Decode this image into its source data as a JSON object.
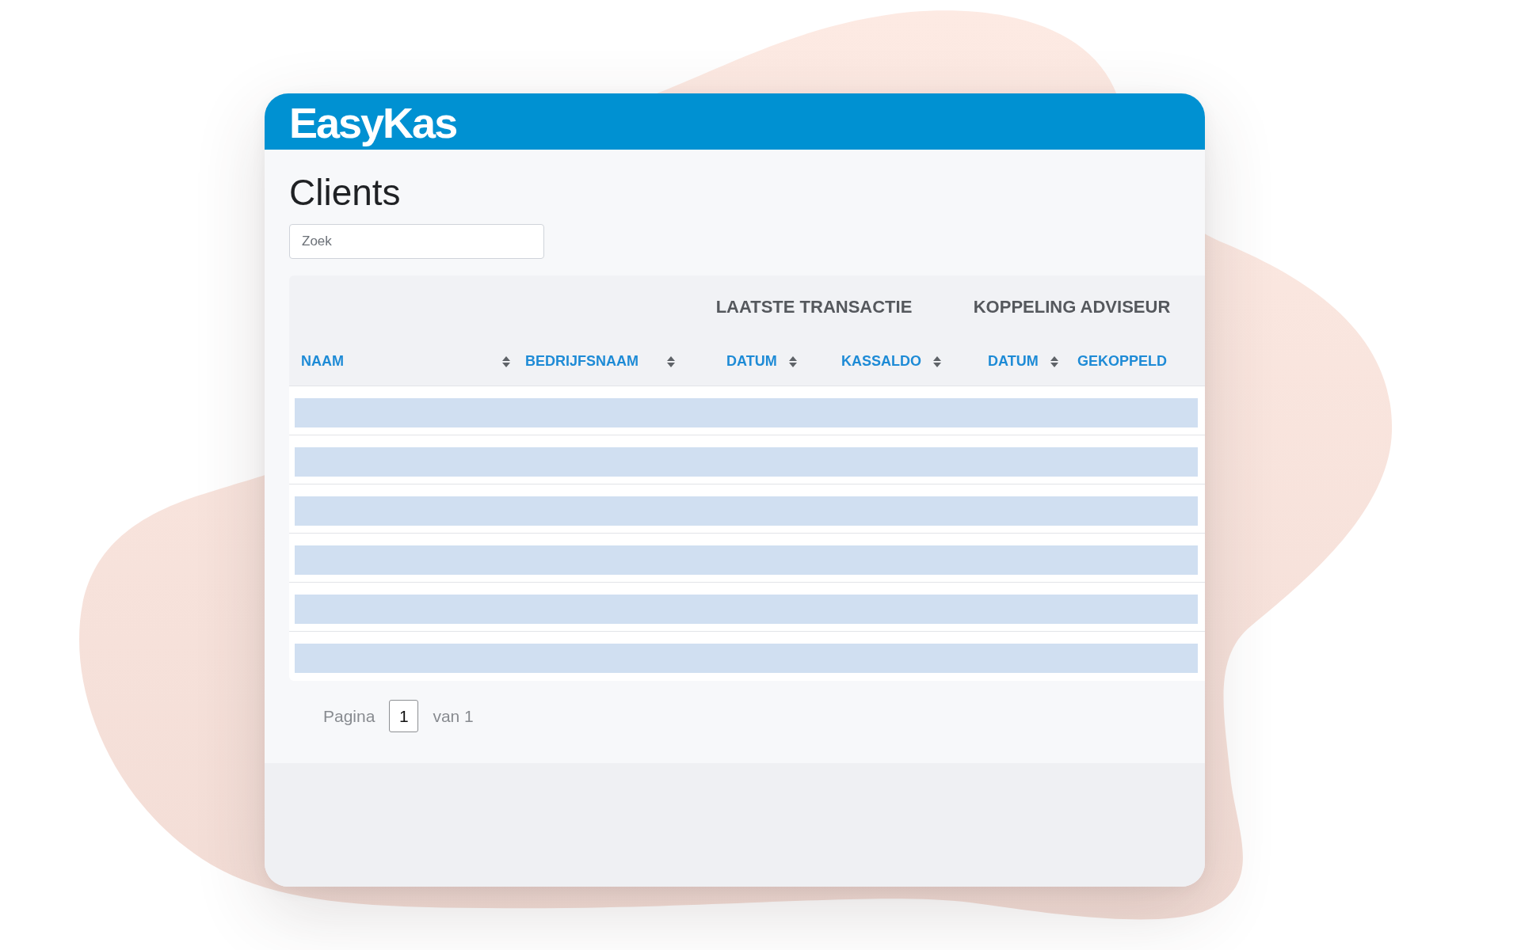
{
  "header": {
    "logo": "EasyKas"
  },
  "page": {
    "title": "Clients"
  },
  "search": {
    "placeholder": "Zoek"
  },
  "table": {
    "column_groups": [
      {
        "columns": [
          {
            "label": "NAAM",
            "sortable": true
          },
          {
            "label": "BEDRIJFSNAAM",
            "sortable": true
          }
        ]
      },
      {
        "label": "LAATSTE TRANSACTIE",
        "columns": [
          {
            "label": "DATUM",
            "sortable": true
          },
          {
            "label": "KASSALDO",
            "sortable": true
          }
        ]
      },
      {
        "label": "KOPPELING ADVISEUR",
        "columns": [
          {
            "label": "DATUM",
            "sortable": true
          },
          {
            "label": "GEKOPPELD",
            "sortable": false
          }
        ]
      }
    ],
    "rows": [
      {
        "loading": true
      },
      {
        "loading": true
      },
      {
        "loading": true
      },
      {
        "loading": true
      },
      {
        "loading": true
      },
      {
        "loading": true
      }
    ]
  },
  "pagination": {
    "label": "Pagina",
    "page": "1",
    "total": "van 1"
  }
}
